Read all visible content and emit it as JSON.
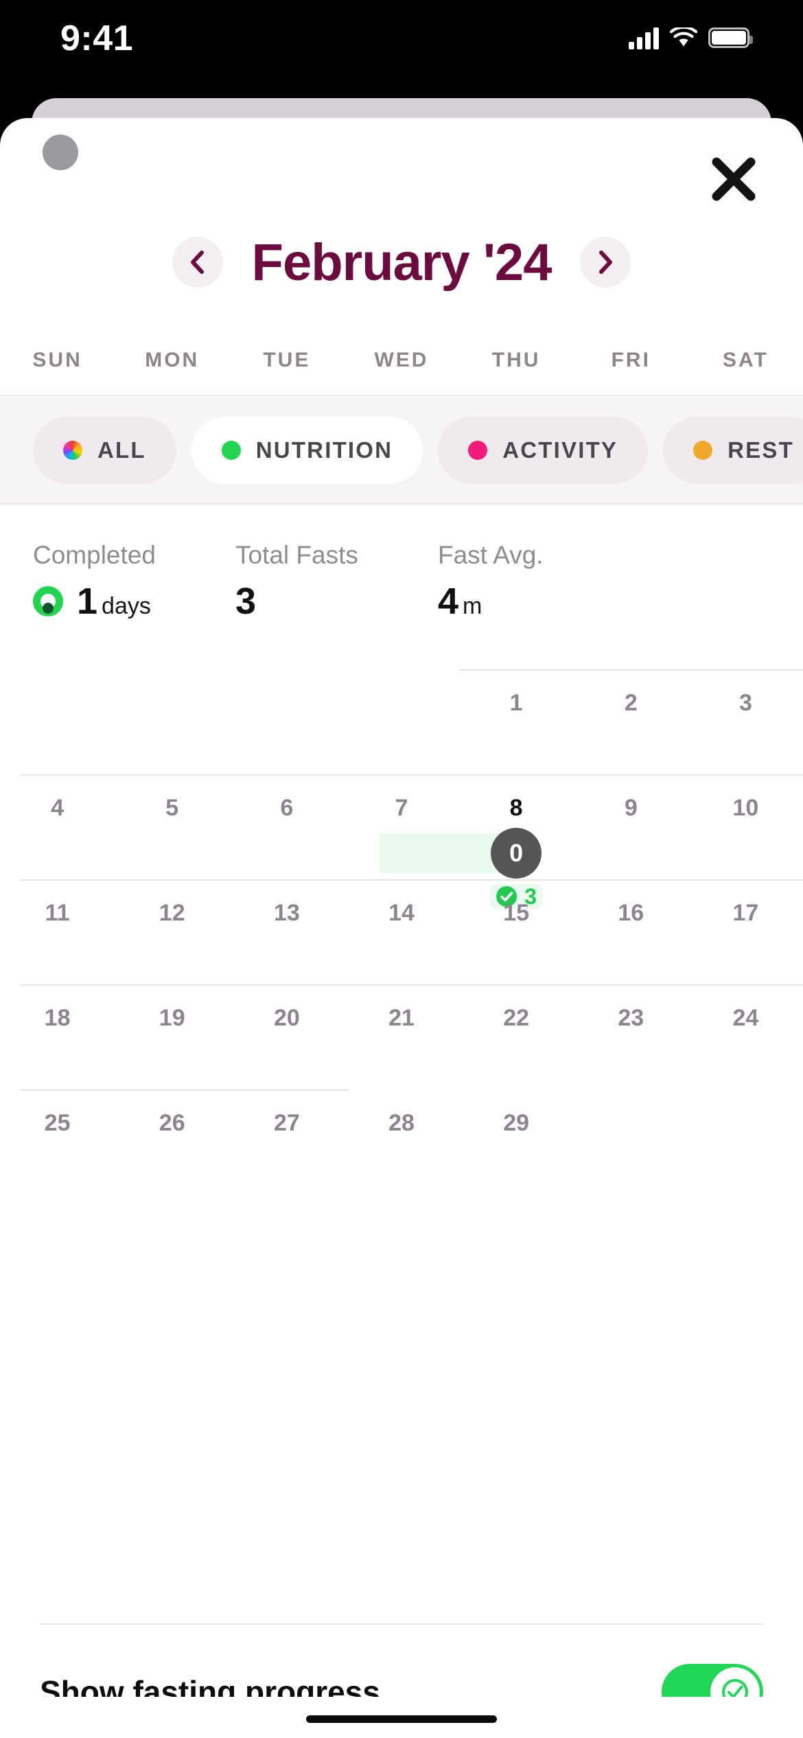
{
  "status_bar": {
    "time": "9:41",
    "signal_icon": "cellular-signal-icon",
    "wifi_icon": "wifi-icon",
    "battery_icon": "battery-icon"
  },
  "sheet": {
    "grab_handle": "drag-handle",
    "close_icon": "close-icon"
  },
  "header": {
    "prev_icon": "chevron-left-icon",
    "next_icon": "chevron-right-icon",
    "title": "February '24",
    "title_color": "#6c0b3d"
  },
  "weekdays": [
    "SUN",
    "MON",
    "TUE",
    "WED",
    "THU",
    "FRI",
    "SAT"
  ],
  "filters": {
    "items": [
      {
        "label": "ALL",
        "dot": "rainbow",
        "color": "",
        "active": false
      },
      {
        "label": "NUTRITION",
        "dot": "solid",
        "color": "#22d44f",
        "active": true
      },
      {
        "label": "ACTIVITY",
        "dot": "solid",
        "color": "#f21b7a",
        "active": false
      },
      {
        "label": "REST",
        "dot": "solid",
        "color": "#f0a82c",
        "active": false
      }
    ]
  },
  "stats": [
    {
      "caption": "Completed",
      "value": "1",
      "unit": "days",
      "icon": "completed-ring-icon"
    },
    {
      "caption": "Total Fasts",
      "value": "3",
      "unit": "",
      "icon": ""
    },
    {
      "caption": "Fast Avg.",
      "value": "4",
      "unit": "m",
      "icon": ""
    }
  ],
  "calendar": {
    "weeks": [
      {
        "days": [
          "",
          "",
          "",
          "",
          "1",
          "2",
          "3"
        ]
      },
      {
        "days": [
          "4",
          "5",
          "6",
          "7",
          "8",
          "9",
          "10"
        ]
      },
      {
        "days": [
          "11",
          "12",
          "13",
          "14",
          "15",
          "16",
          "17"
        ]
      },
      {
        "days": [
          "18",
          "19",
          "20",
          "21",
          "22",
          "23",
          "24"
        ]
      },
      {
        "days": [
          "25",
          "26",
          "27",
          "28",
          "29",
          "",
          ""
        ]
      }
    ],
    "today": "8",
    "fast_marker": {
      "day": "8",
      "circle_value": "0",
      "badge_count": "3",
      "badge_icon": "check-circle-icon",
      "bar_color": "#e9f9ee",
      "circle_color": "#565659",
      "badge_color": "#22c94e"
    }
  },
  "footer": {
    "toggle_label": "Show fasting progress",
    "toggle_on": true,
    "toggle_color": "#22d655",
    "knob_icon": "check-circle-icon"
  }
}
